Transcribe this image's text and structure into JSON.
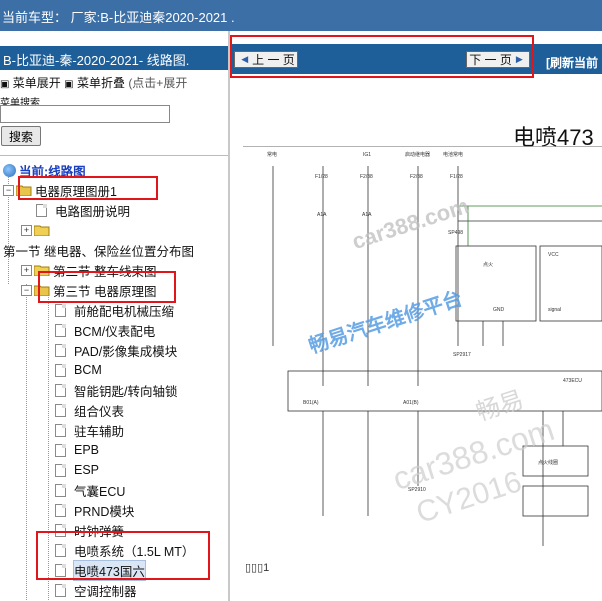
{
  "header": {
    "text": "当前车型：  厂家:B-比亚迪秦2020-2021  ."
  },
  "sidebar": {
    "title": "B-比亚迪-秦-2020-2021- 线路图.",
    "menu_expand": "菜单展开",
    "menu_collapse": "菜单折叠",
    "menu_hint": "(点击+展开",
    "search_label": "菜单搜索",
    "search_button": "搜索",
    "tree": {
      "current": "当前:线路图",
      "items": [
        "电器原理图册1",
        "电路图册说明",
        "",
        "第一节 继电器、保险丝位置分布图",
        "第二节 整车线束图",
        "第三节 电器原理图",
        "前舱配电机械压缩",
        "BCM/仪表配电",
        "PAD/影像集成模块",
        "BCM",
        "智能钥匙/转向轴锁",
        "组合仪表",
        "驻车辅助",
        "EPB",
        "ESP",
        "气囊ECU",
        "PRND模块",
        "时钟弹簧",
        "电喷系统（1.5L MT）",
        "电喷473国六",
        "空调控制器"
      ]
    }
  },
  "viewer": {
    "prev_label": "上 一 页",
    "next_label": "下 一 页",
    "refresh_label": "[刷新当前",
    "doc_title": "电喷473",
    "page_mark": "1",
    "labels": {
      "c1": "常电",
      "c2": "IG1",
      "c3": "启动继电器",
      "c4": "电池常电",
      "f1": "F1/28",
      "f2": "F2/38",
      "f3": "F2/38",
      "f4": "F1/28",
      "a1": "A1A",
      "a2": "A1A",
      "r1": "点火",
      "r2": "GND",
      "r3": "VCC",
      "r4": "signal",
      "r5": "473ECU",
      "r6": "点火线圈",
      "b1": "B01(A)",
      "b2": "A01(B)",
      "s1": "SP2910",
      "s2": "SP2917",
      "s3": "SP498"
    }
  },
  "watermarks": {
    "w1": "car388.com",
    "w2": "畅易汽车维修平台",
    "w3": "畅易",
    "w4": "car388.com",
    "w5": "CY2016"
  }
}
